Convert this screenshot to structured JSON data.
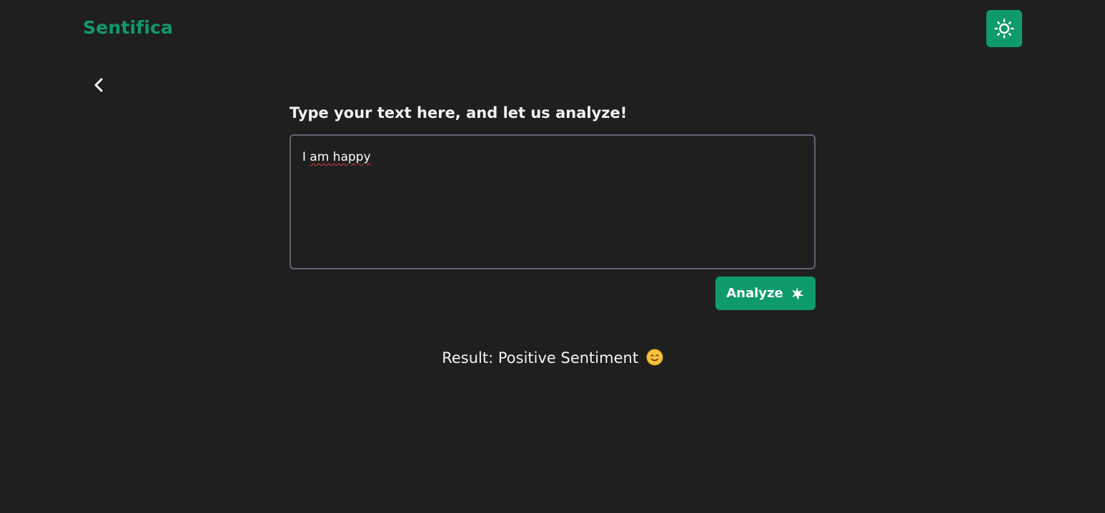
{
  "header": {
    "brand": "Sentifica",
    "theme_toggle_icon": "sun-icon"
  },
  "nav": {
    "back_icon": "chevron-left-icon"
  },
  "form": {
    "prompt": "Type your text here, and let us analyze!",
    "input_first_word": "I",
    "input_rest": "am happy",
    "analyze_label": "Analyze",
    "analyze_icon": "sparkle-icon"
  },
  "result": {
    "text": "Result: Positive Sentiment",
    "emoji_icon": "smiling-face-icon"
  },
  "colors": {
    "background": "#1f1f1f",
    "accent": "#0f9a6b",
    "input_border": "#5d6470"
  }
}
